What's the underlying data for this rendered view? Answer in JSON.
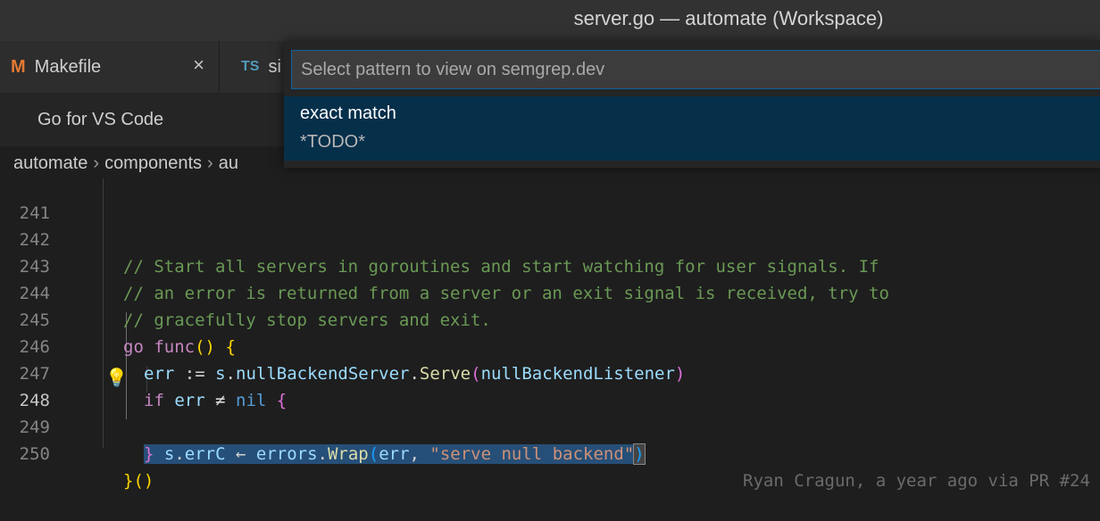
{
  "window": {
    "title": "server.go — automate (Workspace)"
  },
  "tabs": [
    {
      "icon": "M",
      "icon_color": "#e37933",
      "label": "Makefile",
      "close": "×"
    },
    {
      "icon": "TS",
      "icon_color": "#519aba",
      "label": "si"
    }
  ],
  "toolbar": {
    "extension_label": "Go for VS Code"
  },
  "breadcrumb": [
    "automate",
    "components",
    "au"
  ],
  "quick_pick": {
    "placeholder": "Select pattern to view on semgrep.dev",
    "items": [
      {
        "label": "exact match",
        "detail": "*TODO*"
      }
    ]
  },
  "editor": {
    "lines": [
      {
        "number": "241"
      },
      {
        "number": "242",
        "text": "// Start all servers in goroutines and start watching for user signals. If"
      },
      {
        "number": "243",
        "text": "// an error is returned from a server or an exit signal is received, try to"
      },
      {
        "number": "244",
        "text": "// gracefully stop servers and exit."
      },
      {
        "number": "245",
        "t1": "go",
        "t2": "func",
        "t3": "()",
        "t4": " {"
      },
      {
        "number": "246",
        "t1": "err",
        "t2": " := ",
        "t3": "s",
        "t4": ".",
        "t5": "nullBackendServer",
        "t6": ".",
        "t7": "Serve",
        "t8": "(",
        "t9": "nullBackendListener",
        "t10": ")"
      },
      {
        "number": "247",
        "t1": "if",
        "t2": " err ",
        "t3": "≠",
        "t4": " ",
        "t5": "nil",
        "t6": " {"
      },
      {
        "number": "248",
        "t1": "s",
        "t2": ".",
        "t3": "errC",
        "t4": " ← ",
        "t5": "errors",
        "t6": ".",
        "t7": "Wrap",
        "t8": "(",
        "t9": "err",
        "t10": ", ",
        "t11": "\"serve null backend\"",
        "t12": ")"
      },
      {
        "number": "249",
        "t1": "}"
      },
      {
        "number": "250",
        "t1": "}",
        "t2": "()"
      }
    ],
    "blame": "Ryan Cragun, a year ago via PR #24"
  }
}
